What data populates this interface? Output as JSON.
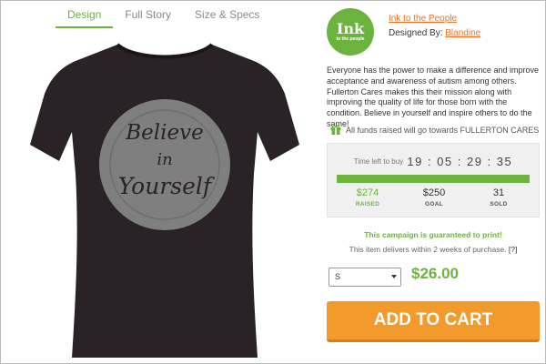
{
  "tabs": [
    {
      "label": "Design"
    },
    {
      "label": "Full Story"
    },
    {
      "label": "Size & Specs"
    }
  ],
  "product": {
    "design_text": [
      "Believe",
      "in",
      "Yourself"
    ],
    "shirt_color": "#2a2226"
  },
  "brand": {
    "logo_line1": "Ink",
    "logo_line2": "to the people",
    "name": "Ink to the People",
    "designed_by_label": "Designed By:",
    "designer": "Blandine"
  },
  "description": "Everyone has the power to make a difference and improve acceptance and awareness of autism among others. Fullerton Cares makes this their mission along with improving the quality of life for those born with the condition. Believe in yourself and inspire others to do the same!",
  "funds_note": "All funds raised will go towards FULLERTON CARES",
  "campaign": {
    "time_left_label": "Time left to buy",
    "time_left": "19 : 05 : 29 : 35",
    "progress": 1.0,
    "raised": {
      "value": "$274",
      "label": "RAISED"
    },
    "goal": {
      "value": "$250",
      "label": "GOAL"
    },
    "sold": {
      "value": "31",
      "label": "SOLD"
    }
  },
  "guarantee": "This campaign is guaranteed to print!",
  "delivery": {
    "text": "This item delivers within 2 weeks of purchase.",
    "help": "[?]"
  },
  "size_select": {
    "selected": "S"
  },
  "price": "$26.00",
  "add_to_cart": "ADD TO CART",
  "colors": {
    "accent": "#6cb33e",
    "cta": "#f39a2d",
    "link": "#e8742b"
  }
}
